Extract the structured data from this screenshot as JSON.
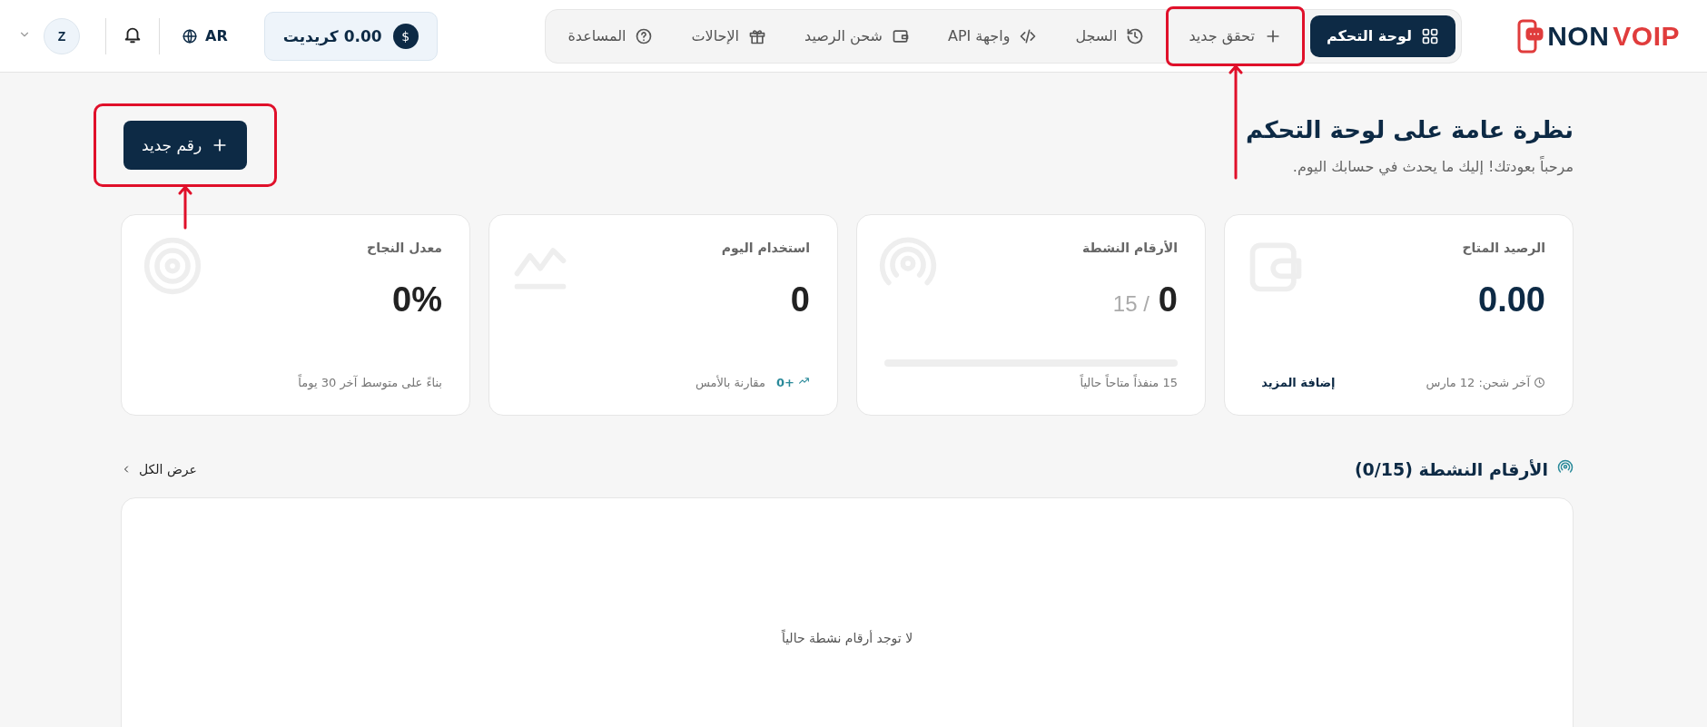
{
  "logo": {
    "part_a": "NON",
    "part_b": "VOIP"
  },
  "nav": [
    {
      "label": "لوحة التحكم",
      "selected": true,
      "annotated": false
    },
    {
      "label": "تحقق جديد",
      "selected": false,
      "annotated": true
    },
    {
      "label": "السجل",
      "selected": false,
      "annotated": false
    },
    {
      "label": "واجهة API",
      "selected": false,
      "annotated": false
    },
    {
      "label": "شحن الرصيد",
      "selected": false,
      "annotated": false
    },
    {
      "label": "الإحالات",
      "selected": false,
      "annotated": false
    },
    {
      "label": "المساعدة",
      "selected": false,
      "annotated": false
    }
  ],
  "credit": {
    "symbol": "$",
    "label": "0.00 كريديت"
  },
  "language": "AR",
  "avatar": "Z",
  "page": {
    "title": "نظرة عامة على لوحة التحكم",
    "subtitle": "مرحباً بعودتك! إليك ما يحدث في حسابك اليوم."
  },
  "new_number_button": {
    "label": "رقم جديد",
    "annotated": true
  },
  "cards": [
    {
      "kind": "balance",
      "label": "الرصيد المتاح",
      "value": "0.00",
      "footer": "آخر شحن: 12 مارس",
      "action": "إضافة المزيد"
    },
    {
      "kind": "progress",
      "label": "الأرقام النشطة",
      "value": "0",
      "total": "/ 15",
      "level": 0,
      "footer": "15 منفذاً متاحاً حالياً"
    },
    {
      "kind": "trend",
      "label": "استخدام اليوم",
      "value": "0",
      "delta": "+0",
      "footer": "مقارنة بالأمس"
    },
    {
      "kind": "plain",
      "label": "معدل النجاح",
      "value": "0%",
      "footer": "بناءً على متوسط آخر 30 يوماً"
    }
  ],
  "active_numbers": {
    "title": "الأرقام النشطة (0/15)",
    "view_all": "عرض الكل",
    "empty": "لا توجد أرقام نشطة حالياً"
  }
}
